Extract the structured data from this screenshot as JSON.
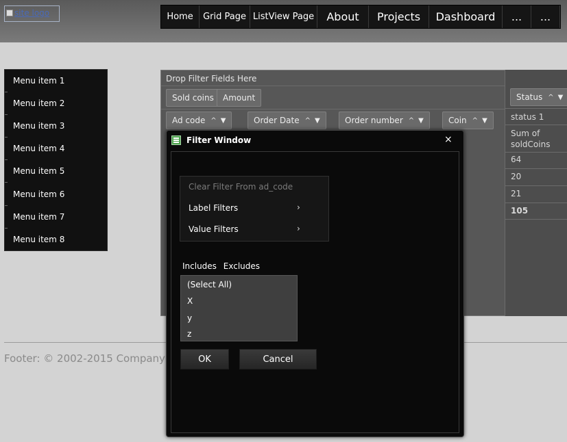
{
  "header": {
    "logo_alt": "site logo",
    "nav": [
      "Home",
      "Grid Page",
      "ListView Page",
      "About",
      "Projects",
      "Dashboard",
      "...",
      "..."
    ]
  },
  "sidebar": {
    "items": [
      "Menu item 1",
      "Menu item 2",
      "Menu item 3",
      "Menu item 4",
      "Menu item 5",
      "Menu item 6",
      "Menu item 7",
      "Menu item 8"
    ]
  },
  "grid": {
    "drop_filter_text": "Drop Filter Fields Here",
    "data_fields": [
      "Sold coins",
      "Amount"
    ],
    "column_field": "Status",
    "row_fields": [
      "Ad code",
      "Order Date",
      "Order number",
      "Coin"
    ],
    "status_header": "status 1",
    "sum_label": "Sum of soldCoins",
    "values": [
      "64",
      "20",
      "21"
    ],
    "total": "105"
  },
  "footer": {
    "text": "Footer: © 2002-2015 Company In"
  },
  "dialog": {
    "title": "Filter Window",
    "close_glyph": "×",
    "menu": {
      "clear": "Clear Filter From ad_code",
      "label_filters": "Label Filters",
      "value_filters": "Value Filters"
    },
    "tabs": [
      "Includes",
      "Excludes"
    ],
    "list": [
      "(Select All)",
      "X",
      "y",
      "z"
    ],
    "ok": "OK",
    "cancel": "Cancel"
  },
  "icons": {
    "sort": "sort-asc-icon",
    "filter": "filter-icon",
    "chevron": "chevron-right-icon"
  }
}
